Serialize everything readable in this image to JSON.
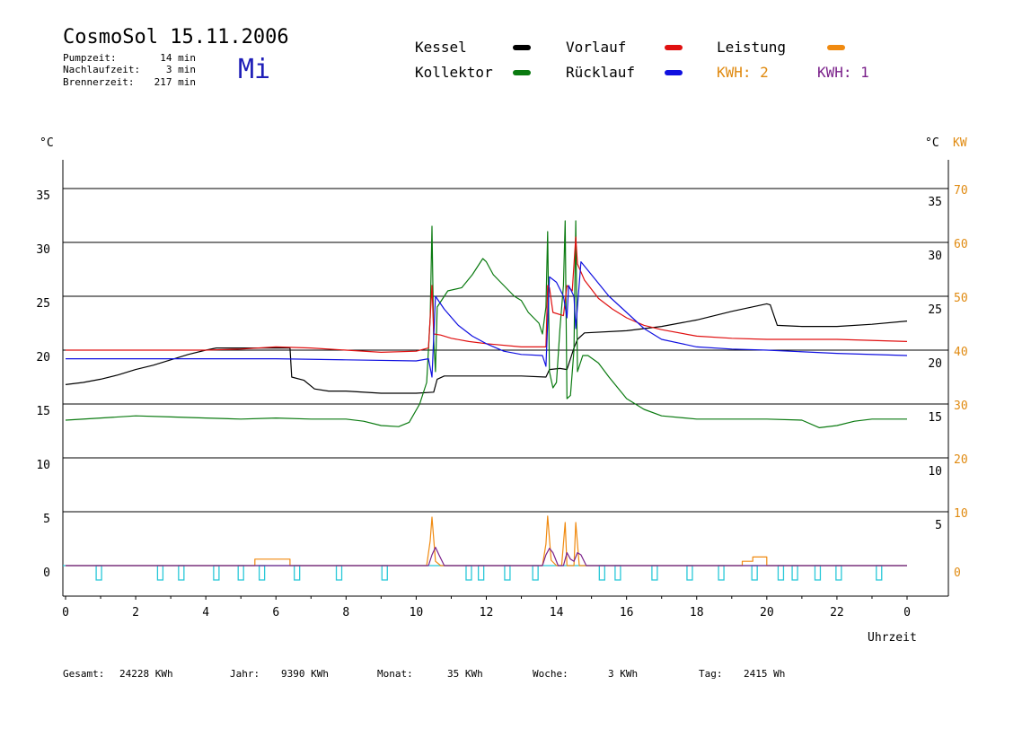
{
  "header": {
    "title": "CosmoSol 15.11.2006",
    "weekday": "Mi",
    "stats": [
      {
        "label": "Pumpzeit:",
        "value": "14 min"
      },
      {
        "label": "Nachlaufzeit:",
        "value": "3 min"
      },
      {
        "label": "Brennerzeit:",
        "value": "217 min"
      }
    ]
  },
  "legend": {
    "kessel": {
      "label": "Kessel",
      "color": "#000000"
    },
    "kollektor": {
      "label": "Kollektor",
      "color": "#0a7a10"
    },
    "vorlauf": {
      "label": "Vorlauf",
      "color": "#e01010"
    },
    "ruecklauf": {
      "label": "Rücklauf",
      "color": "#1010e0"
    },
    "leistung": {
      "label": "Leistung",
      "color": "#f08a10"
    },
    "kwh2": {
      "label": "KWH: 2",
      "color": "#e08a10"
    },
    "kwh1": {
      "label": "KWH: 1",
      "color": "#7a208a"
    }
  },
  "footer": [
    {
      "label": "Gesamt:",
      "value": "24228 KWh"
    },
    {
      "label": "Jahr:",
      "value": "9390 KWh"
    },
    {
      "label": "Monat:",
      "value": "35 KWh"
    },
    {
      "label": "Woche:",
      "value": "3 KWh"
    },
    {
      "label": "Tag:",
      "value": "2415 Wh"
    }
  ],
  "chart_data": {
    "type": "line",
    "title": "CosmoSol 15.11.2006",
    "xlabel": "Uhrzeit",
    "ylabel_left": "°C",
    "ylabel_right": "°C",
    "ylabel_right2": "KW",
    "xlim": [
      0,
      24
    ],
    "ylim": [
      0,
      35
    ],
    "grid": true,
    "x_ticks": [
      "0",
      "2",
      "4",
      "6",
      "8",
      "10",
      "12",
      "14",
      "16",
      "18",
      "20",
      "22",
      "0"
    ],
    "y_ticks_left": [
      "0",
      "5",
      "10",
      "15",
      "20",
      "25",
      "30",
      "35"
    ],
    "y_ticks_right": [
      "5",
      "10",
      "15",
      "20",
      "25",
      "30",
      "35"
    ],
    "y_ticks_kw": [
      "0",
      "10",
      "20",
      "30",
      "40",
      "50",
      "60",
      "70"
    ],
    "series": [
      {
        "name": "Kessel",
        "color": "#000000",
        "points": [
          [
            0,
            16.8
          ],
          [
            0.5,
            17.0
          ],
          [
            1,
            17.3
          ],
          [
            1.5,
            17.7
          ],
          [
            2,
            18.2
          ],
          [
            2.5,
            18.6
          ],
          [
            3,
            19.1
          ],
          [
            3.5,
            19.6
          ],
          [
            4,
            20.0
          ],
          [
            4.3,
            20.2
          ],
          [
            6.4,
            20.2
          ],
          [
            6.45,
            17.5
          ],
          [
            6.8,
            17.2
          ],
          [
            7.1,
            16.4
          ],
          [
            7.5,
            16.2
          ],
          [
            8,
            16.2
          ],
          [
            9,
            16.0
          ],
          [
            10,
            16.0
          ],
          [
            10.5,
            16.1
          ],
          [
            10.6,
            17.3
          ],
          [
            10.8,
            17.6
          ],
          [
            12,
            17.6
          ],
          [
            13,
            17.6
          ],
          [
            13.7,
            17.5
          ],
          [
            13.8,
            18.2
          ],
          [
            14.1,
            18.3
          ],
          [
            14.3,
            18.2
          ],
          [
            14.5,
            20.2
          ],
          [
            14.6,
            21.0
          ],
          [
            14.8,
            21.6
          ],
          [
            16,
            21.8
          ],
          [
            17,
            22.2
          ],
          [
            18,
            22.8
          ],
          [
            19,
            23.6
          ],
          [
            20,
            24.3
          ],
          [
            20.1,
            24.2
          ],
          [
            20.3,
            22.3
          ],
          [
            21,
            22.2
          ],
          [
            22,
            22.2
          ],
          [
            23,
            22.4
          ],
          [
            24,
            22.7
          ]
        ]
      },
      {
        "name": "Vorlauf",
        "color": "#e01010",
        "points": [
          [
            0,
            20.0
          ],
          [
            2,
            20.0
          ],
          [
            4,
            20.0
          ],
          [
            5,
            20.1
          ],
          [
            6,
            20.3
          ],
          [
            7,
            20.2
          ],
          [
            8,
            20.0
          ],
          [
            9,
            19.8
          ],
          [
            10,
            19.9
          ],
          [
            10.35,
            20.2
          ],
          [
            10.45,
            26.0
          ],
          [
            10.5,
            21.5
          ],
          [
            10.7,
            21.4
          ],
          [
            11,
            21.1
          ],
          [
            11.5,
            20.8
          ],
          [
            12,
            20.6
          ],
          [
            13,
            20.3
          ],
          [
            13.7,
            20.3
          ],
          [
            13.75,
            26.0
          ],
          [
            13.8,
            25.8
          ],
          [
            13.9,
            23.5
          ],
          [
            14.2,
            23.2
          ],
          [
            14.3,
            26.0
          ],
          [
            14.45,
            25.5
          ],
          [
            14.55,
            30.5
          ],
          [
            14.6,
            28.0
          ],
          [
            14.8,
            26.5
          ],
          [
            15.2,
            24.8
          ],
          [
            15.6,
            23.8
          ],
          [
            16,
            23.0
          ],
          [
            16.5,
            22.3
          ],
          [
            17,
            21.9
          ],
          [
            18,
            21.3
          ],
          [
            19,
            21.1
          ],
          [
            20,
            21.0
          ],
          [
            22,
            21.0
          ],
          [
            24,
            20.8
          ]
        ]
      },
      {
        "name": "Rücklauf",
        "color": "#1010e0",
        "points": [
          [
            0,
            19.2
          ],
          [
            6,
            19.2
          ],
          [
            8,
            19.1
          ],
          [
            10,
            19.0
          ],
          [
            10.35,
            19.2
          ],
          [
            10.45,
            17.5
          ],
          [
            10.55,
            25.0
          ],
          [
            10.8,
            23.8
          ],
          [
            11.2,
            22.3
          ],
          [
            11.6,
            21.3
          ],
          [
            12,
            20.6
          ],
          [
            12.5,
            19.9
          ],
          [
            13,
            19.6
          ],
          [
            13.6,
            19.5
          ],
          [
            13.7,
            18.5
          ],
          [
            13.8,
            26.8
          ],
          [
            14,
            26.3
          ],
          [
            14.2,
            25.0
          ],
          [
            14.3,
            23.0
          ],
          [
            14.35,
            26.0
          ],
          [
            14.5,
            25.0
          ],
          [
            14.55,
            22.0
          ],
          [
            14.7,
            28.2
          ],
          [
            15,
            27.0
          ],
          [
            15.5,
            25.0
          ],
          [
            16,
            23.5
          ],
          [
            16.5,
            22.0
          ],
          [
            17,
            21.0
          ],
          [
            18,
            20.3
          ],
          [
            19,
            20.1
          ],
          [
            20,
            20.0
          ],
          [
            22,
            19.7
          ],
          [
            24,
            19.5
          ]
        ]
      },
      {
        "name": "Kollektor",
        "color": "#0a7a10",
        "points": [
          [
            0,
            13.5
          ],
          [
            1,
            13.7
          ],
          [
            2,
            13.9
          ],
          [
            3,
            13.8
          ],
          [
            4,
            13.7
          ],
          [
            5,
            13.6
          ],
          [
            6,
            13.7
          ],
          [
            7,
            13.6
          ],
          [
            8,
            13.6
          ],
          [
            8.5,
            13.4
          ],
          [
            9,
            13.0
          ],
          [
            9.5,
            12.9
          ],
          [
            9.8,
            13.3
          ],
          [
            10.1,
            15.0
          ],
          [
            10.3,
            17.0
          ],
          [
            10.4,
            23.0
          ],
          [
            10.45,
            31.5
          ],
          [
            10.5,
            21.0
          ],
          [
            10.55,
            18.0
          ],
          [
            10.6,
            24.0
          ],
          [
            10.9,
            25.5
          ],
          [
            11.3,
            25.8
          ],
          [
            11.6,
            27.0
          ],
          [
            11.9,
            28.5
          ],
          [
            12,
            28.2
          ],
          [
            12.2,
            27.0
          ],
          [
            12.5,
            26.0
          ],
          [
            12.8,
            25.0
          ],
          [
            13,
            24.6
          ],
          [
            13.2,
            23.5
          ],
          [
            13.5,
            22.5
          ],
          [
            13.6,
            21.5
          ],
          [
            13.7,
            24.0
          ],
          [
            13.75,
            31.0
          ],
          [
            13.8,
            18.0
          ],
          [
            13.9,
            16.5
          ],
          [
            14.0,
            17.0
          ],
          [
            14.1,
            22.0
          ],
          [
            14.2,
            26.0
          ],
          [
            14.25,
            32.0
          ],
          [
            14.3,
            15.5
          ],
          [
            14.4,
            15.8
          ],
          [
            14.5,
            20.0
          ],
          [
            14.55,
            32.0
          ],
          [
            14.6,
            18.0
          ],
          [
            14.75,
            19.5
          ],
          [
            14.9,
            19.5
          ],
          [
            15.2,
            18.8
          ],
          [
            15.5,
            17.5
          ],
          [
            16,
            15.5
          ],
          [
            16.5,
            14.5
          ],
          [
            17,
            13.9
          ],
          [
            18,
            13.6
          ],
          [
            19,
            13.6
          ],
          [
            20,
            13.6
          ],
          [
            21,
            13.5
          ],
          [
            21.5,
            12.8
          ],
          [
            22,
            13.0
          ],
          [
            22.5,
            13.4
          ],
          [
            23,
            13.6
          ],
          [
            24,
            13.6
          ]
        ]
      }
    ],
    "power": {
      "name": "Leistung",
      "color": "#f08a10",
      "points": [
        [
          0,
          0
        ],
        [
          5.4,
          0
        ],
        [
          5.4,
          0.6
        ],
        [
          6.4,
          0.6
        ],
        [
          6.4,
          0
        ],
        [
          10.3,
          0
        ],
        [
          10.4,
          2.3
        ],
        [
          10.45,
          4.5
        ],
        [
          10.55,
          0.4
        ],
        [
          10.7,
          0
        ],
        [
          13.6,
          0
        ],
        [
          13.7,
          2.0
        ],
        [
          13.75,
          4.6
        ],
        [
          13.85,
          0.5
        ],
        [
          14.0,
          0
        ],
        [
          14.15,
          0
        ],
        [
          14.25,
          4.0
        ],
        [
          14.3,
          0
        ],
        [
          14.5,
          0
        ],
        [
          14.55,
          4.0
        ],
        [
          14.65,
          0
        ],
        [
          19.3,
          0
        ],
        [
          19.3,
          0.4
        ],
        [
          19.6,
          0.4
        ],
        [
          19.6,
          0.8
        ],
        [
          20.0,
          0.8
        ],
        [
          20.0,
          0
        ],
        [
          24,
          0
        ]
      ]
    },
    "energy_kwh1": {
      "name": "KWH: 1",
      "color": "#7a208a",
      "points": [
        [
          0,
          0
        ],
        [
          10.35,
          0
        ],
        [
          10.45,
          1.0
        ],
        [
          10.55,
          1.7
        ],
        [
          10.65,
          1.0
        ],
        [
          10.8,
          0
        ],
        [
          13.6,
          0
        ],
        [
          13.7,
          1.0
        ],
        [
          13.8,
          1.6
        ],
        [
          13.9,
          1.2
        ],
        [
          14.05,
          0
        ],
        [
          14.2,
          0
        ],
        [
          14.3,
          1.2
        ],
        [
          14.4,
          0.6
        ],
        [
          14.5,
          0.4
        ],
        [
          14.6,
          1.2
        ],
        [
          14.7,
          1.0
        ],
        [
          14.85,
          0
        ],
        [
          24,
          0
        ]
      ]
    },
    "pump_cycles": [
      0.95,
      2.7,
      3.3,
      4.3,
      5.0,
      5.6,
      6.6,
      7.8,
      9.1,
      11.5,
      11.85,
      12.6,
      13.4,
      15.3,
      15.75,
      16.8,
      17.8,
      18.7,
      19.65,
      20.4,
      20.8,
      21.45,
      22.05,
      23.2
    ]
  }
}
